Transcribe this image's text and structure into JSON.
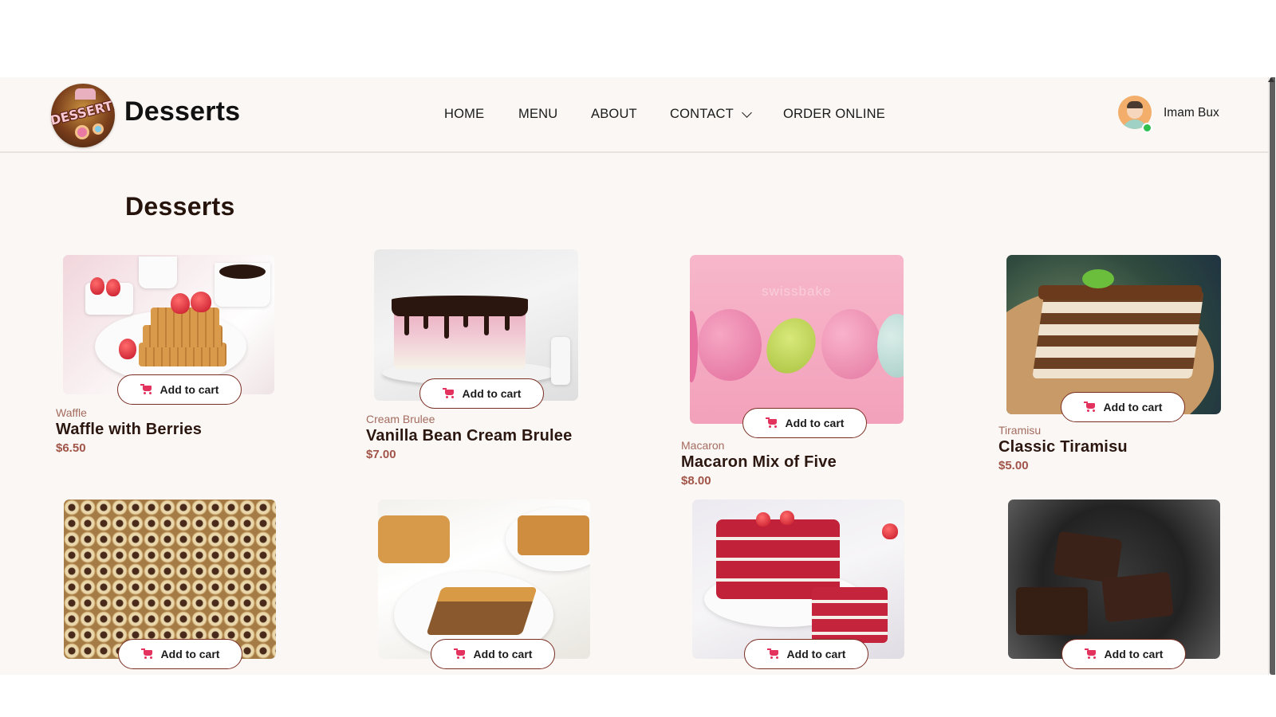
{
  "brand": {
    "name": "Desserts",
    "logo_text": "DESSERTS"
  },
  "nav": {
    "items": [
      "HOME",
      "MENU",
      "ABOUT",
      "CONTACT",
      "ORDER ONLINE"
    ]
  },
  "user": {
    "name": "Imam Bux",
    "status": "online"
  },
  "page": {
    "title": "Desserts"
  },
  "cart_label": "Add to cart",
  "products": [
    {
      "category": "Waffle",
      "name": "Waffle with Berries",
      "price": "$6.50"
    },
    {
      "category": "Cream Brulee",
      "name": "Vanilla Bean Cream Brulee",
      "price": "$7.00"
    },
    {
      "category": "Macaron",
      "name": "Macaron Mix of Five",
      "price": "$8.00",
      "watermark": "swissbake"
    },
    {
      "category": "Tiramisu",
      "name": "Classic Tiramisu",
      "price": "$5.00"
    },
    {
      "category": "",
      "name": "",
      "price": ""
    },
    {
      "category": "",
      "name": "",
      "price": ""
    },
    {
      "category": "",
      "name": "",
      "price": ""
    },
    {
      "category": "",
      "name": "",
      "price": ""
    }
  ],
  "colors": {
    "background": "#faf7f4",
    "accent": "#a15448",
    "cart_icon": "#e2325d",
    "online": "#2fbf4f"
  }
}
